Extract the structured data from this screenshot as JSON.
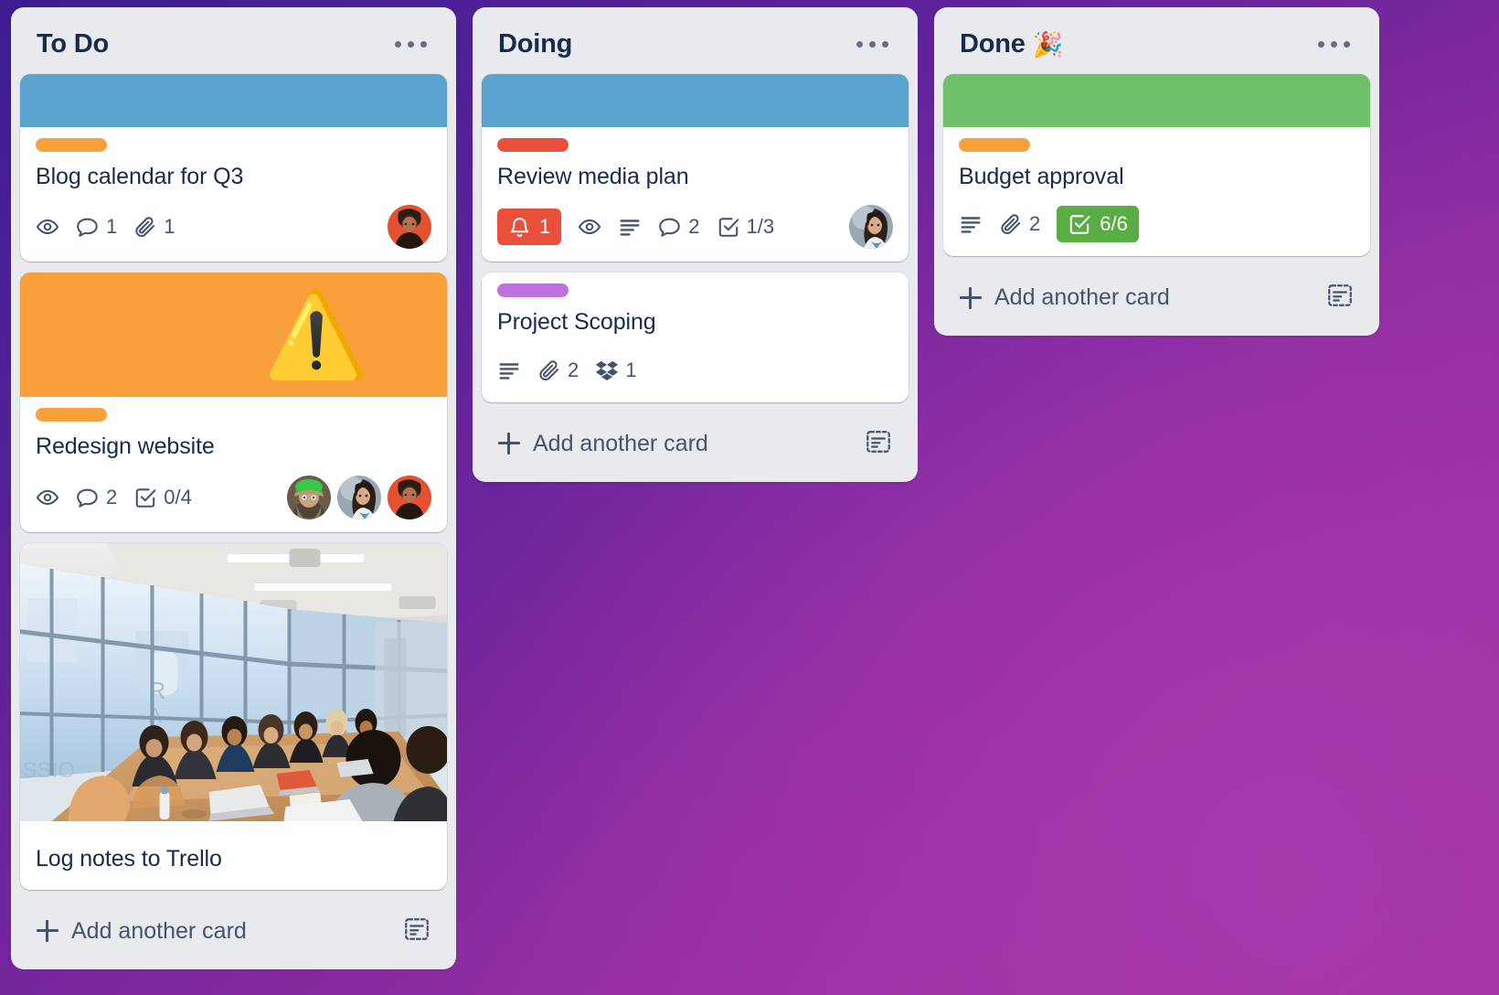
{
  "board": {
    "background_colors": {
      "top_left": "#3b1d8f",
      "bottom_right": "#a3339f",
      "accent": "#8a2b9f"
    },
    "lists": [
      {
        "id": "to-do",
        "title": "To Do",
        "emoji": "",
        "menu_label": "list-actions",
        "add_card_label": "Add another card",
        "template_icon": "card-template-icon",
        "cards": [
          {
            "id": "blog-calendar",
            "title": "Blog calendar for Q3",
            "cover": {
              "type": "color",
              "color": "#5ba4cf",
              "name": "blue"
            },
            "labels": [
              {
                "color": "#f8a13c",
                "name": "orange"
              }
            ],
            "badges": [
              {
                "icon": "eye-icon",
                "text": ""
              },
              {
                "icon": "comment-icon",
                "text": "1"
              },
              {
                "icon": "attachment-icon",
                "text": "1"
              }
            ],
            "members": [
              {
                "name": "avatar-photo-red"
              }
            ]
          },
          {
            "id": "redesign-website",
            "title": "Redesign website",
            "cover": {
              "type": "color-emoji",
              "color": "#f9a03c",
              "name": "orange",
              "emoji": "⚠️"
            },
            "labels": [
              {
                "color": "#f8a13c",
                "name": "orange"
              }
            ],
            "badges": [
              {
                "icon": "eye-icon",
                "text": ""
              },
              {
                "icon": "comment-icon",
                "text": "2"
              },
              {
                "icon": "checklist-icon",
                "text": "0/4"
              }
            ],
            "members": [
              {
                "name": "avatar-cartoon-greencap"
              },
              {
                "name": "avatar-photo-grey"
              },
              {
                "name": "avatar-photo-red"
              }
            ]
          },
          {
            "id": "log-notes-trello",
            "title": "Log notes to Trello",
            "cover": {
              "type": "photo",
              "name": "conference-room-meeting-photo"
            },
            "labels": [],
            "badges": [],
            "members": []
          }
        ]
      },
      {
        "id": "doing",
        "title": "Doing",
        "emoji": "",
        "menu_label": "list-actions",
        "add_card_label": "Add another card",
        "template_icon": "card-template-icon",
        "cards": [
          {
            "id": "review-media-plan",
            "title": "Review media plan",
            "cover": {
              "type": "color",
              "color": "#5ba4cf",
              "name": "blue"
            },
            "labels": [
              {
                "color": "#e8503a",
                "name": "red"
              }
            ],
            "badges": [
              {
                "icon": "due-date-bell-icon",
                "text": "1",
                "style": "pill-red",
                "color": "#e8503a"
              },
              {
                "icon": "eye-icon",
                "text": ""
              },
              {
                "icon": "description-icon",
                "text": ""
              },
              {
                "icon": "comment-icon",
                "text": "2"
              },
              {
                "icon": "checklist-icon",
                "text": "1/3"
              }
            ],
            "members": [
              {
                "name": "avatar-photo-grey"
              }
            ]
          },
          {
            "id": "project-scoping",
            "title": "Project Scoping",
            "cover": null,
            "labels": [
              {
                "color": "#bd72dd",
                "name": "purple"
              }
            ],
            "badges": [
              {
                "icon": "description-icon",
                "text": ""
              },
              {
                "icon": "attachment-icon",
                "text": "2"
              },
              {
                "icon": "dropbox-icon",
                "text": "1"
              }
            ],
            "members": []
          }
        ]
      },
      {
        "id": "done",
        "title": "Done",
        "emoji": "🎉",
        "menu_label": "list-actions",
        "add_card_label": "Add another card",
        "template_icon": "card-template-icon",
        "cards": [
          {
            "id": "budget-approval",
            "title": "Budget approval",
            "cover": {
              "type": "color",
              "color": "#6fc06a",
              "name": "green"
            },
            "labels": [
              {
                "color": "#f8a13c",
                "name": "orange"
              }
            ],
            "badges": [
              {
                "icon": "description-icon",
                "text": ""
              },
              {
                "icon": "attachment-icon",
                "text": "2"
              },
              {
                "icon": "checklist-icon",
                "text": "6/6",
                "style": "pill-green",
                "color": "#5aac44"
              }
            ],
            "members": []
          }
        ]
      }
    ]
  }
}
